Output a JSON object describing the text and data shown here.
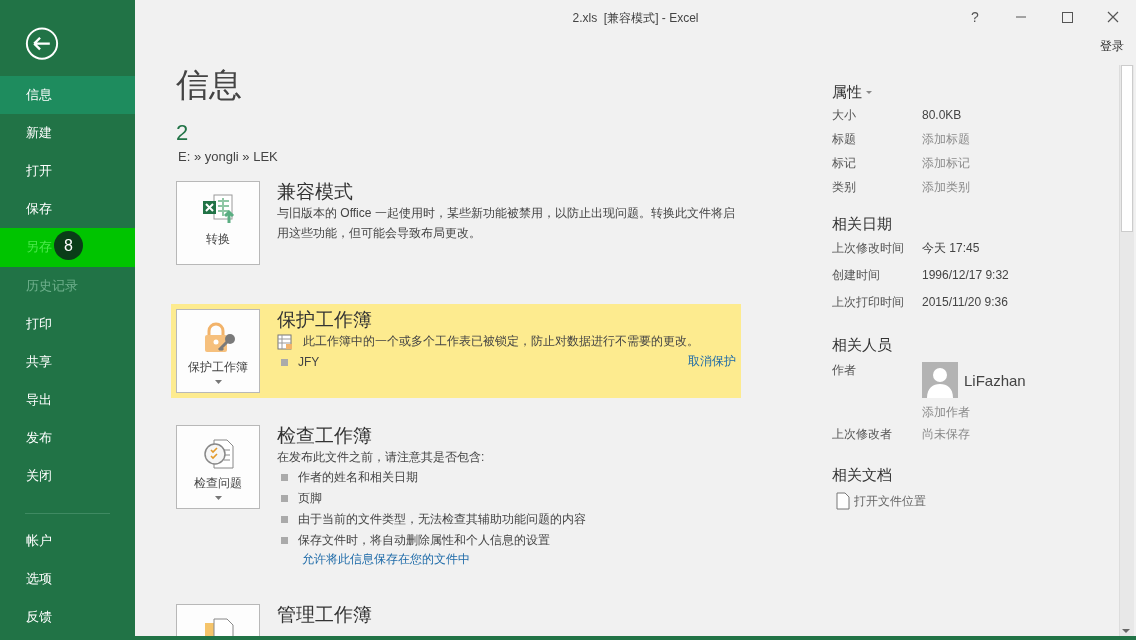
{
  "window": {
    "title": "2.xls  [兼容模式] - Excel",
    "help": "?",
    "sign_in": "登录"
  },
  "sidebar": {
    "items": [
      {
        "label": "信息",
        "selected": true,
        "disabled": false,
        "highlighted": false
      },
      {
        "label": "新建",
        "selected": false,
        "disabled": false,
        "highlighted": false
      },
      {
        "label": "打开",
        "selected": false,
        "disabled": false,
        "highlighted": false
      },
      {
        "label": "保存",
        "selected": false,
        "disabled": false,
        "highlighted": false
      },
      {
        "label": "另存",
        "selected": false,
        "disabled": false,
        "highlighted": true,
        "badge": "8"
      },
      {
        "label": "历史记录",
        "selected": false,
        "disabled": true,
        "highlighted": false
      },
      {
        "label": "打印",
        "selected": false,
        "disabled": false,
        "highlighted": false
      },
      {
        "label": "共享",
        "selected": false,
        "disabled": false,
        "highlighted": false
      },
      {
        "label": "导出",
        "selected": false,
        "disabled": false,
        "highlighted": false
      },
      {
        "label": "发布",
        "selected": false,
        "disabled": false,
        "highlighted": false
      },
      {
        "label": "关闭",
        "selected": false,
        "disabled": false,
        "highlighted": false
      }
    ],
    "bottom_items": [
      {
        "label": "帐户",
        "selected": false,
        "disabled": false,
        "highlighted": false
      },
      {
        "label": "选项",
        "selected": false,
        "disabled": false,
        "highlighted": false
      },
      {
        "label": "反馈",
        "selected": false,
        "disabled": false,
        "highlighted": false
      }
    ]
  },
  "main": {
    "heading": "信息",
    "file_name": "2",
    "path": "E: » yongli » LEK",
    "sections": [
      {
        "kind": "compat",
        "button": "转换",
        "dropdown": false,
        "highlighted": false,
        "title": "兼容模式",
        "description": "与旧版本的 Office 一起使用时，某些新功能被禁用，以防止出现问题。转换此文件将启用这些功能，但可能会导致布局更改。"
      },
      {
        "kind": "protect",
        "button": "保护工作簿",
        "dropdown": true,
        "highlighted": true,
        "title": "保护工作簿",
        "lines": [
          {
            "kind": "sheet",
            "text": "此工作簿中的一个或多个工作表已被锁定，防止对数据进行不需要的更改。"
          },
          {
            "kind": "bullet",
            "text": "JFY"
          }
        ],
        "link": "取消保护"
      },
      {
        "kind": "inspect",
        "button": "检查问题",
        "dropdown": true,
        "highlighted": false,
        "title": "检查工作簿",
        "description": "在发布此文件之前，请注意其是否包含:",
        "lines": [
          {
            "kind": "bullet",
            "text": "作者的姓名和相关日期"
          },
          {
            "kind": "bullet",
            "text": "页脚"
          },
          {
            "kind": "bullet",
            "text": "由于当前的文件类型，无法检查其辅助功能问题的内容"
          },
          {
            "kind": "bullet",
            "text": "保存文件时，将自动删除属性和个人信息的设置"
          }
        ],
        "link": "允许将此信息保存在您的文件中"
      },
      {
        "kind": "manage",
        "dropdown": false,
        "highlighted": false,
        "title": "管理工作簿"
      }
    ]
  },
  "properties": {
    "title": "属性",
    "rows": [
      {
        "label": "大小",
        "value": "80.0KB",
        "greyed": false
      },
      {
        "label": "标题",
        "value": "添加标题",
        "greyed": true
      },
      {
        "label": "标记",
        "value": "添加标记",
        "greyed": true
      },
      {
        "label": "类别",
        "value": "添加类别",
        "greyed": true
      }
    ],
    "dates_title": "相关日期",
    "dates": [
      {
        "label": "上次修改时间",
        "value": "今天 17:45",
        "greyed": false
      },
      {
        "label": "创建时间",
        "value": "1996/12/17 9:32",
        "greyed": false
      },
      {
        "label": "上次打印时间",
        "value": "2015/11/20 9:36",
        "greyed": false
      }
    ],
    "people_title": "相关人员",
    "author_label": "作者",
    "author_name": "LiFazhan",
    "add_author": "添加作者",
    "modified_by_label": "上次修改者",
    "modified_by": "尚未保存",
    "docs_title": "相关文档",
    "open_location": "打开文件位置"
  }
}
